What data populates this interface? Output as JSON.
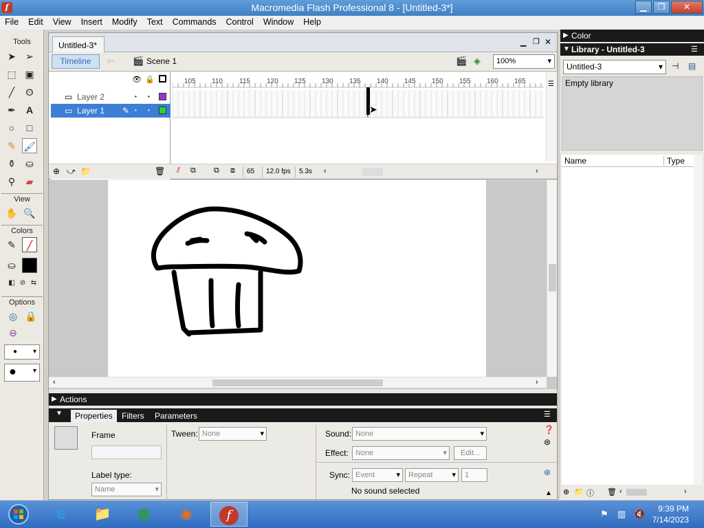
{
  "window": {
    "title": "Macromedia Flash Professional 8 - [Untitled-3*]",
    "app_icon": "f",
    "controls": [
      "minimize-icon",
      "restore-icon",
      "close-icon"
    ]
  },
  "menu": [
    "File",
    "Edit",
    "View",
    "Insert",
    "Modify",
    "Text",
    "Commands",
    "Control",
    "Window",
    "Help"
  ],
  "toolbox": {
    "tools_label": "Tools",
    "view_label": "View",
    "colors_label": "Colors",
    "options_label": "Options",
    "tools": [
      "selection-icon",
      "subselection-icon",
      "free-transform-icon",
      "fill-transform-icon",
      "line-icon",
      "lasso-icon",
      "pen-icon",
      "text-icon",
      "oval-icon",
      "rectangle-icon",
      "pencil-icon",
      "brush-icon",
      "ink-bottle-icon",
      "paint-bucket-icon",
      "eyedropper-icon",
      "eraser-icon",
      "hand-icon",
      "zoom-icon"
    ]
  },
  "document": {
    "tab": "Untitled-3*",
    "timeline_button": "Timeline",
    "scene": "Scene 1",
    "zoom": "100%",
    "layers": [
      {
        "name": "Layer 2",
        "color": "#9933cc",
        "selected": false
      },
      {
        "name": "Layer 1",
        "color": "#33cc33",
        "selected": true
      }
    ],
    "ruler": [
      "105",
      "110",
      "115",
      "120",
      "125",
      "130",
      "135",
      "140",
      "145",
      "150",
      "155",
      "160",
      "165"
    ],
    "status": {
      "frame": "65",
      "fps": "12.0 fps",
      "time": "5.3s"
    }
  },
  "panels": {
    "actions": "Actions",
    "tabs": [
      "Properties",
      "Filters",
      "Parameters"
    ],
    "properties": {
      "type": "Frame",
      "tween_label": "Tween:",
      "tween_value": "None",
      "sound_label": "Sound:",
      "sound_value": "None",
      "effect_label": "Effect:",
      "effect_value": "None",
      "edit_button": "Edit...",
      "label_type_label": "Label type:",
      "label_type_value": "Name",
      "sync_label": "Sync:",
      "sync_value": "Event",
      "repeat_value": "Repeat",
      "repeat_count": "1",
      "no_sound": "No sound selected"
    }
  },
  "right_panel": {
    "color_title": "Color",
    "library_title": "Library - Untitled-3",
    "library_select": "Untitled-3",
    "empty_text": "Empty library",
    "col_name": "Name",
    "col_type": "Type"
  },
  "taskbar": {
    "time": "9:39 PM",
    "date": "7/14/2023",
    "icons": [
      "start-icon",
      "internet-explorer-icon",
      "file-explorer-icon",
      "store-icon",
      "firefox-icon",
      "flash-icon"
    ]
  }
}
